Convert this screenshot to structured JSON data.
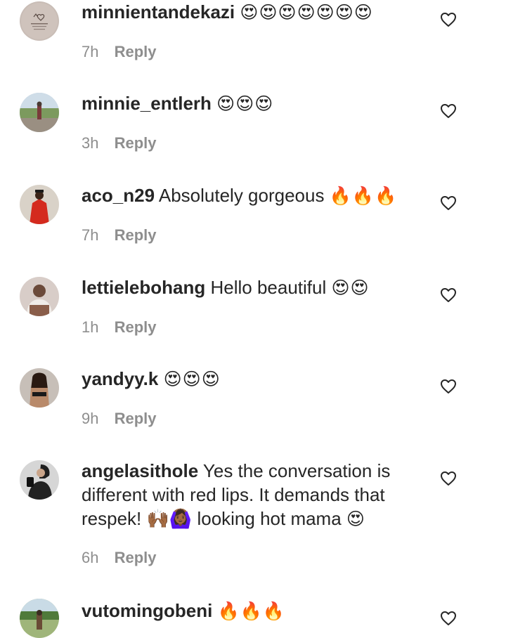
{
  "reply_label": "Reply",
  "comments": [
    {
      "username": "minnientandekazi",
      "text": "",
      "emojis": "😍😍😍😍😍😍😍",
      "time": "7h",
      "avatar_icon": "hearts-drawing-avatar"
    },
    {
      "username": "minnie_entlerh",
      "text": "",
      "emojis": "😍😍😍",
      "time": "3h",
      "avatar_icon": "outdoor-photo-avatar"
    },
    {
      "username": "aco_n29",
      "text": "Absolutely gorgeous",
      "emojis": "🔥🔥🔥",
      "time": "7h",
      "avatar_icon": "red-outfit-avatar"
    },
    {
      "username": "lettielebohang",
      "text": "Hello beautiful",
      "emojis": "😍😍",
      "time": "1h",
      "avatar_icon": "portrait-avatar"
    },
    {
      "username": "yandyy.k",
      "text": "",
      "emojis": "😍😍😍",
      "time": "9h",
      "avatar_icon": "portrait-avatar"
    },
    {
      "username": "angelasithole",
      "text": "Yes the conversation is different with red lips. It demands that respek! 🙌🏾🙆🏾‍♀️ looking hot mama",
      "emojis": "😍",
      "time": "6h",
      "avatar_icon": "portrait-avatar"
    },
    {
      "username": "vutomingobeni",
      "text": "",
      "emojis": "🔥🔥🔥",
      "time": "",
      "avatar_icon": "outdoor-photo-avatar"
    }
  ],
  "colors": {
    "text": "#262626",
    "muted": "#8e8e8e",
    "background": "#ffffff"
  }
}
